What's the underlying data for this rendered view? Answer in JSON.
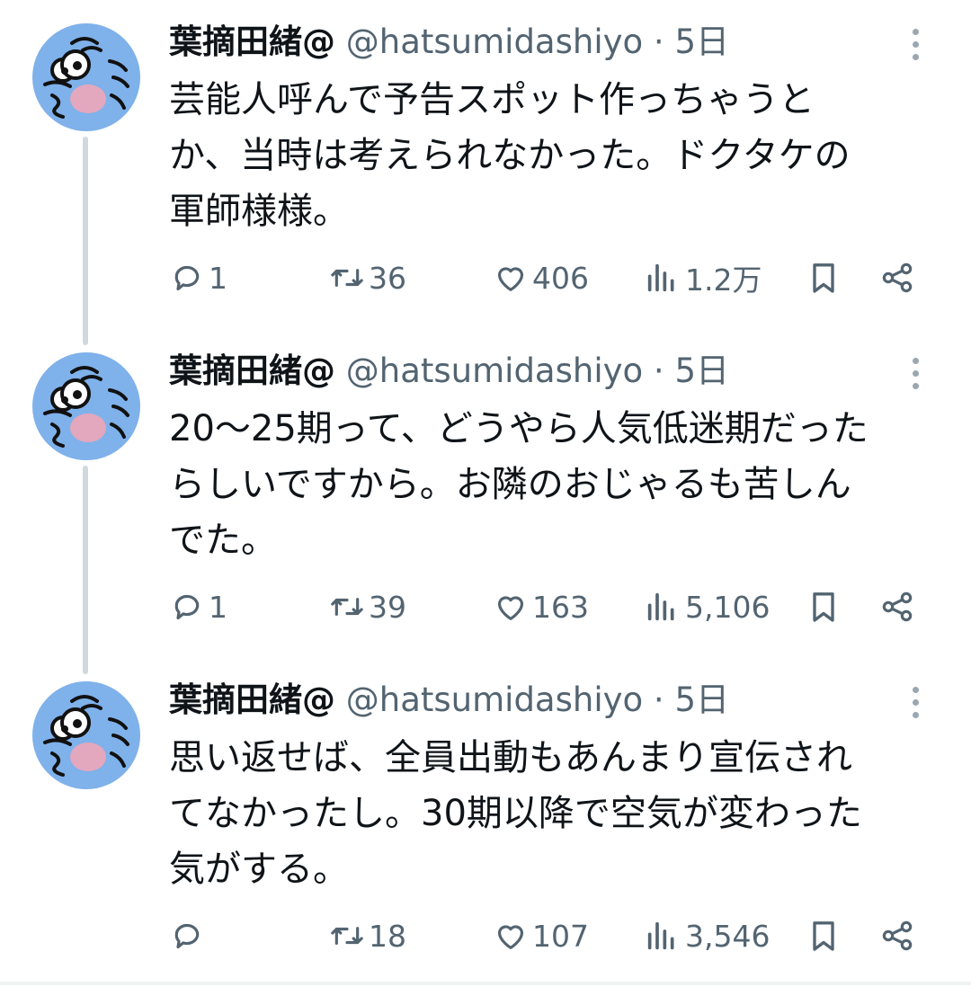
{
  "colors": {
    "text": "#0f1419",
    "secondary": "#536471",
    "avatar_bg": "#7fb1ea",
    "thread_line": "#cfd9de"
  },
  "icons": {
    "reply": "reply-icon",
    "retweet": "retweet-icon",
    "like": "heart-icon",
    "views": "views-icon",
    "bookmark": "bookmark-icon",
    "share": "share-icon",
    "more": "more-vertical-icon"
  },
  "tweets": [
    {
      "name": "葉摘田緒@",
      "handle": "@hatsumidashiyo",
      "separator": "·",
      "time": "5日",
      "lines": [
        "芸能人呼んで予告スポット作っちゃうと",
        "か、当時は考えられなかった。ドクタケの",
        "軍師様様。"
      ],
      "replies": "1",
      "retweets": "36",
      "likes": "406",
      "views": "1.2万"
    },
    {
      "name": "葉摘田緒@",
      "handle": "@hatsumidashiyo",
      "separator": "·",
      "time": "5日",
      "lines": [
        "20〜25期って、どうやら人気低迷期だった",
        "らしいですから。お隣のおじゃるも苦しん",
        "でた。"
      ],
      "replies": "1",
      "retweets": "39",
      "likes": "163",
      "views": "5,106"
    },
    {
      "name": "葉摘田緒@",
      "handle": "@hatsumidashiyo",
      "separator": "·",
      "time": "5日",
      "lines": [
        "思い返せば、全員出動もあんまり宣伝され",
        "てなかったし。30期以降で空気が変わった",
        "気がする。"
      ],
      "replies": "",
      "retweets": "18",
      "likes": "107",
      "views": "3,546"
    }
  ]
}
